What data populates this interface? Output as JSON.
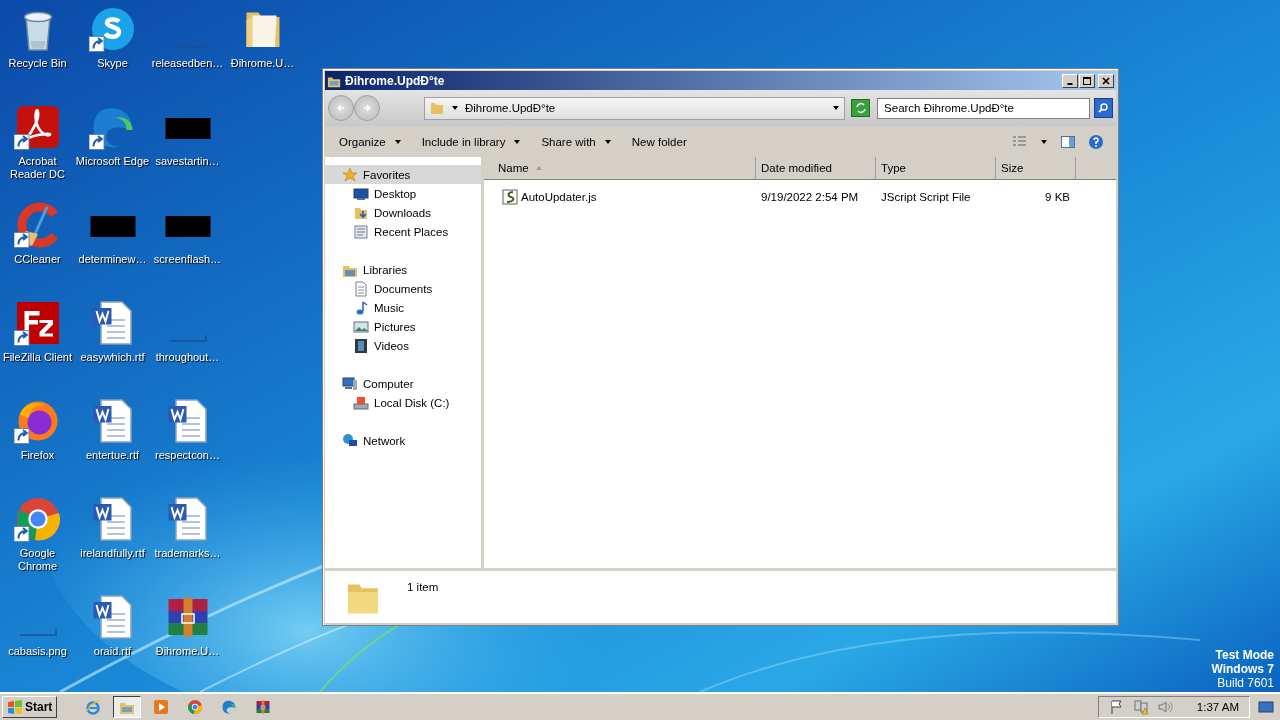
{
  "desktop_icons": [
    {
      "label": "Recycle Bin",
      "kind": "recycle",
      "shortcut": false
    },
    {
      "label": "Acrobat Reader DC",
      "kind": "acrobat",
      "shortcut": true
    },
    {
      "label": "CCleaner",
      "kind": "ccleaner",
      "shortcut": true
    },
    {
      "label": "FileZilla Client",
      "kind": "filezilla",
      "shortcut": true
    },
    {
      "label": "Firefox",
      "kind": "firefox",
      "shortcut": true
    },
    {
      "label": "Google Chrome",
      "kind": "chrome",
      "shortcut": true
    },
    {
      "label": "cabasis.png",
      "kind": "blank",
      "shortcut": false
    },
    {
      "label": "Skype",
      "kind": "skype",
      "shortcut": true
    },
    {
      "label": "Microsoft Edge",
      "kind": "edge",
      "shortcut": true
    },
    {
      "label": "determinew…",
      "kind": "black",
      "shortcut": false
    },
    {
      "label": "easywhich.rtf",
      "kind": "word",
      "shortcut": false
    },
    {
      "label": "entertue.rtf",
      "kind": "word",
      "shortcut": false
    },
    {
      "label": "irelandfully.rtf",
      "kind": "word",
      "shortcut": false
    },
    {
      "label": "oraid.rtf",
      "kind": "word",
      "shortcut": false
    },
    {
      "label": "releasedben…",
      "kind": "blank",
      "shortcut": false
    },
    {
      "label": "savestartin…",
      "kind": "black",
      "shortcut": false
    },
    {
      "label": "screenflash…",
      "kind": "black",
      "shortcut": false
    },
    {
      "label": "throughout…",
      "kind": "blank",
      "shortcut": false
    },
    {
      "label": "respectcon…",
      "kind": "word",
      "shortcut": false
    },
    {
      "label": "trademarks…",
      "kind": "word",
      "shortcut": false
    },
    {
      "label": "Đihrome.U…",
      "kind": "winrar",
      "shortcut": false
    },
    {
      "label": "Đihrome.U…",
      "kind": "folder",
      "shortcut": false
    }
  ],
  "window": {
    "title": "Đihrome.UpdÐ°te",
    "address": "Đihrome.UpdÐ°te",
    "search": {
      "placeholder": "Search Đihrome.UpdÐ°te"
    },
    "toolbar": [
      {
        "label": "Organize",
        "dropdown": true
      },
      {
        "label": "Include in library",
        "dropdown": true
      },
      {
        "label": "Share with",
        "dropdown": true
      },
      {
        "label": "New folder",
        "dropdown": false
      }
    ],
    "nav": [
      {
        "label": "Favorites",
        "selected": true,
        "children": [
          {
            "label": "Desktop",
            "selected": false
          },
          {
            "label": "Downloads",
            "selected": false
          },
          {
            "label": "Recent Places",
            "selected": false
          }
        ]
      },
      {
        "label": "Libraries",
        "selected": false,
        "children": [
          {
            "label": "Documents",
            "selected": false
          },
          {
            "label": "Music",
            "selected": false
          },
          {
            "label": "Pictures",
            "selected": false
          },
          {
            "label": "Videos",
            "selected": false
          }
        ]
      },
      {
        "label": "Computer",
        "selected": false,
        "children": [
          {
            "label": "Local Disk (C:)",
            "selected": false
          }
        ]
      },
      {
        "label": "Network",
        "selected": false
      }
    ],
    "columns": [
      {
        "label": "Name",
        "sorted": true
      },
      {
        "label": "Date modified",
        "sorted": false
      },
      {
        "label": "Type",
        "sorted": false
      },
      {
        "label": "Size",
        "sorted": false
      }
    ],
    "files": [
      {
        "name": "AutoUpdater.js",
        "date": "9/19/2022 2:54 PM",
        "type": "JScript Script File",
        "size": "9 KB"
      }
    ],
    "details": {
      "count": "1 item"
    }
  },
  "desktop_notice": [
    "Test Mode",
    "Windows 7",
    "Build 7601"
  ],
  "taskbar": {
    "start": "Start",
    "apps": [
      {
        "kind": "ie",
        "selected": false
      },
      {
        "kind": "explorer",
        "selected": true
      },
      {
        "kind": "media",
        "selected": false
      },
      {
        "kind": "chrome",
        "selected": false
      },
      {
        "kind": "edge",
        "selected": false
      },
      {
        "kind": "winrar",
        "selected": false
      }
    ],
    "clock": "1:37 AM"
  }
}
